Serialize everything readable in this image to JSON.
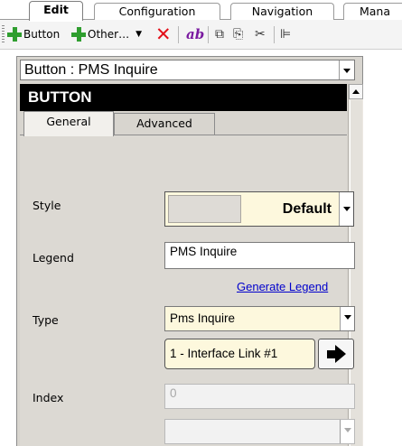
{
  "tabs": [
    {
      "label": "Edit",
      "active": true
    },
    {
      "label": "Configuration",
      "active": false
    },
    {
      "label": "Navigation",
      "active": false
    },
    {
      "label": "Mana",
      "active": false
    }
  ],
  "toolbar": {
    "add_button_label": "Button",
    "add_other_label": "Other…",
    "icons": [
      "plus-icon",
      "plus-icon",
      "delete-x-icon",
      "text-ab-icon",
      "copy-icon",
      "paste-icon",
      "cut-icon",
      "align-left-icon"
    ]
  },
  "object_selector": {
    "value": "Button : PMS Inquire"
  },
  "panel_header": {
    "title": "BUTTON"
  },
  "subtabs": [
    {
      "label": "General",
      "active": true
    },
    {
      "label": "Advanced",
      "active": false
    }
  ],
  "form": {
    "style": {
      "label": "Style",
      "value": "Default"
    },
    "legend": {
      "label": "Legend",
      "value": "PMS Inquire"
    },
    "generate_legend_link": "Generate Legend",
    "type": {
      "label": "Type",
      "value": "Pms Inquire"
    },
    "interface_link": {
      "value": "1 - Interface Link #1"
    },
    "index": {
      "label": "Index",
      "value": "0"
    }
  },
  "colors": {
    "header_bg": "#000000",
    "panel_bg": "#d8d5cf",
    "field_highlight": "#fdf8dd",
    "link_color": "#0000cc",
    "add_icon": "#2f9e2f",
    "delete_icon": "#e3101a"
  }
}
